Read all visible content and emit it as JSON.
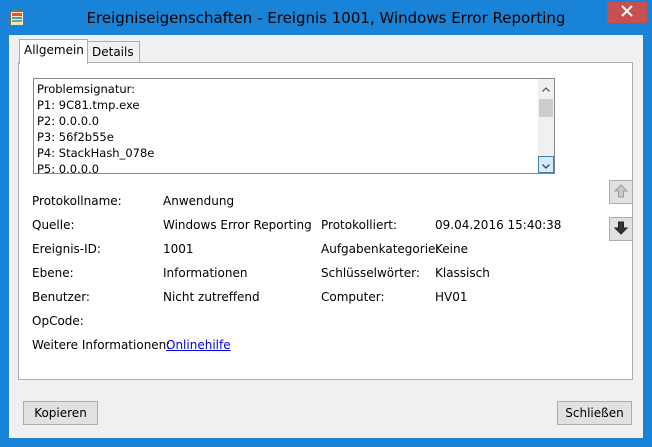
{
  "window": {
    "title": "Ereigniseigenschaften - Ereignis 1001, Windows Error Reporting",
    "accent_color": "#1883d7",
    "close_color": "#c75050"
  },
  "tabs": [
    {
      "label": "Allgemein",
      "active": true
    },
    {
      "label": "Details",
      "active": false
    }
  ],
  "description_lines": [
    "Problemsignatur:",
    "P1: 9C81.tmp.exe",
    "P2: 0.0.0.0",
    "P3: 56f2b55e",
    "P4: StackHash_078e",
    "P5: 0.0.0.0"
  ],
  "fields": {
    "protokollname": {
      "label": "Protokollname:",
      "value": "Anwendung"
    },
    "quelle": {
      "label": "Quelle:",
      "value": "Windows Error Reporting"
    },
    "protokolliert": {
      "label": "Protokolliert:",
      "value": "09.04.2016 15:40:38"
    },
    "ereignis_id": {
      "label": "Ereignis-ID:",
      "value": "1001"
    },
    "aufgabenkategorie": {
      "label": "Aufgabenkategorie:",
      "value": "Keine"
    },
    "ebene": {
      "label": "Ebene:",
      "value": "Informationen"
    },
    "schluesselwoerter": {
      "label": "Schlüsselwörter:",
      "value": "Klassisch"
    },
    "benutzer": {
      "label": "Benutzer:",
      "value": "Nicht zutreffend"
    },
    "computer": {
      "label": "Computer:",
      "value": "HV01"
    },
    "opcode": {
      "label": "OpCode:",
      "value": ""
    },
    "weitere": {
      "label": "Weitere Informationen:",
      "link": "Onlinehilfe"
    }
  },
  "buttons": {
    "copy": "Kopieren",
    "close": "Schließen"
  }
}
